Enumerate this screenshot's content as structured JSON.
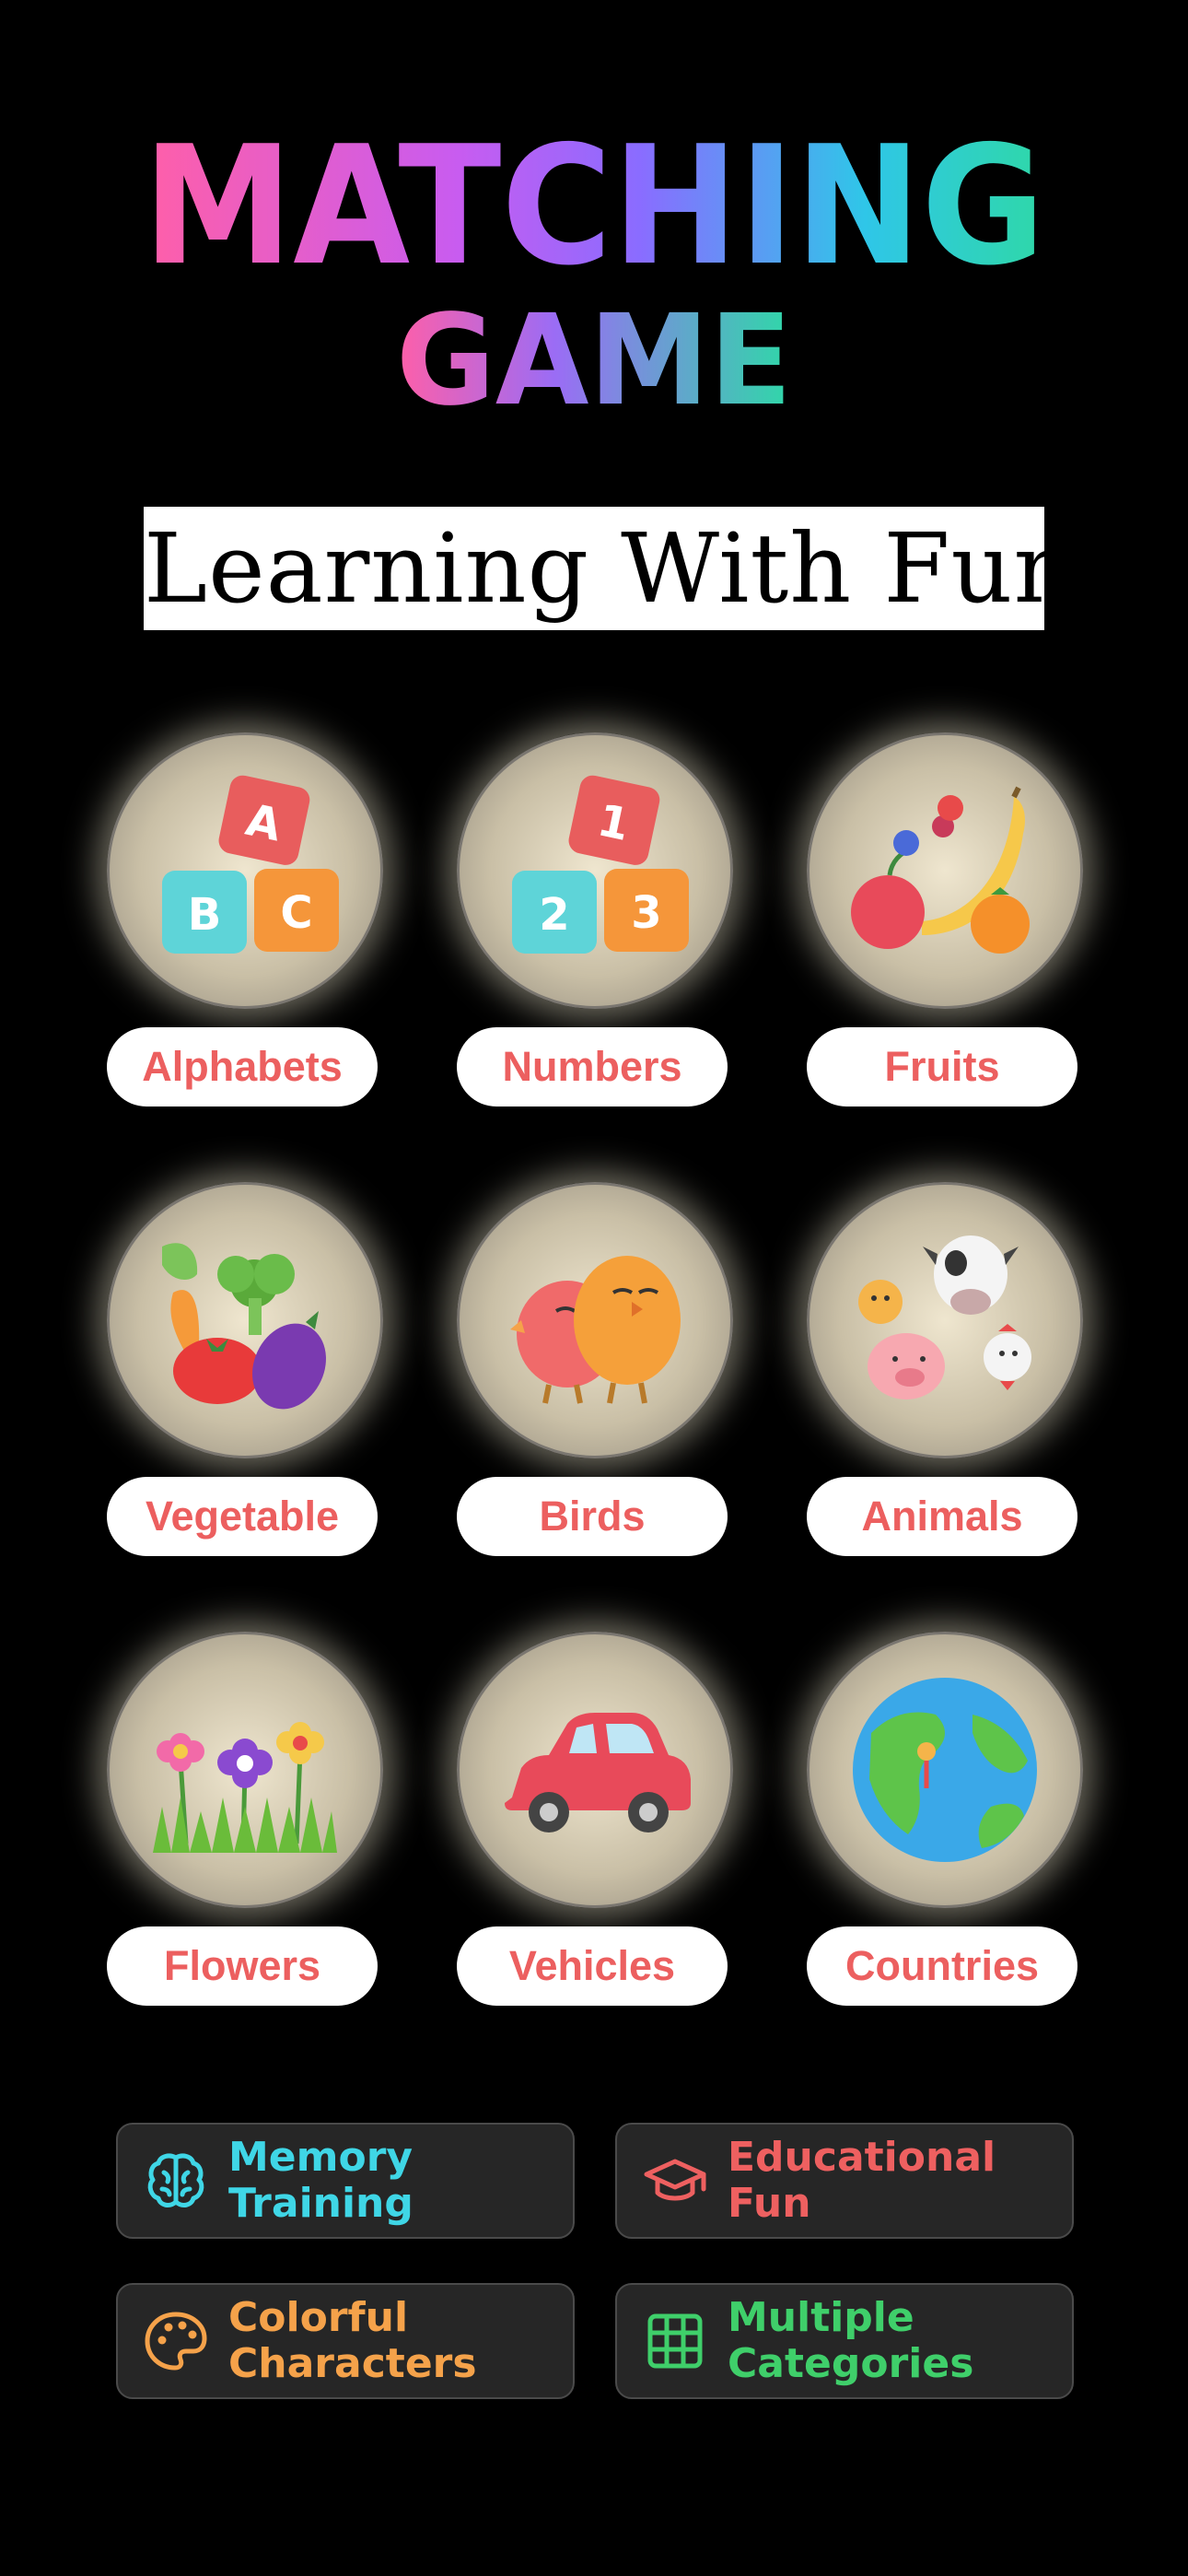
{
  "app": {
    "title_line1": "MATCHING",
    "title_line2": "GAME",
    "tagline": "Learning With Fun"
  },
  "colors": {
    "background": "#000000",
    "label_text": "#ec5f5f",
    "title_gradient": [
      "#ff5fa8",
      "#c85cf0",
      "#8a6cff",
      "#2fc6e8",
      "#2fd8a8"
    ]
  },
  "categories": [
    {
      "label": "Alphabets",
      "icon": "alphabet-blocks-icon"
    },
    {
      "label": "Numbers",
      "icon": "number-blocks-icon"
    },
    {
      "label": "Fruits",
      "icon": "fruits-icon"
    },
    {
      "label": "Vegetable",
      "icon": "vegetables-icon"
    },
    {
      "label": "Birds",
      "icon": "birds-icon"
    },
    {
      "label": "Animals",
      "icon": "animals-icon"
    },
    {
      "label": "Flowers",
      "icon": "flowers-icon"
    },
    {
      "label": "Vehicles",
      "icon": "car-icon"
    },
    {
      "label": "Countries",
      "icon": "globe-icon"
    }
  ],
  "features": [
    {
      "line1": "Memory",
      "line2": "Training",
      "icon": "brain-icon",
      "color": "#3fd6e6"
    },
    {
      "line1": "Educational",
      "line2": "Fun",
      "icon": "graduation-cap-icon",
      "color": "#ee6060"
    },
    {
      "line1": "Colorful",
      "line2": "Characters",
      "icon": "palette-icon",
      "color": "#f5a24a"
    },
    {
      "line1": "Multiple",
      "line2": "Categories",
      "icon": "grid-icon",
      "color": "#3fcf6a"
    }
  ]
}
